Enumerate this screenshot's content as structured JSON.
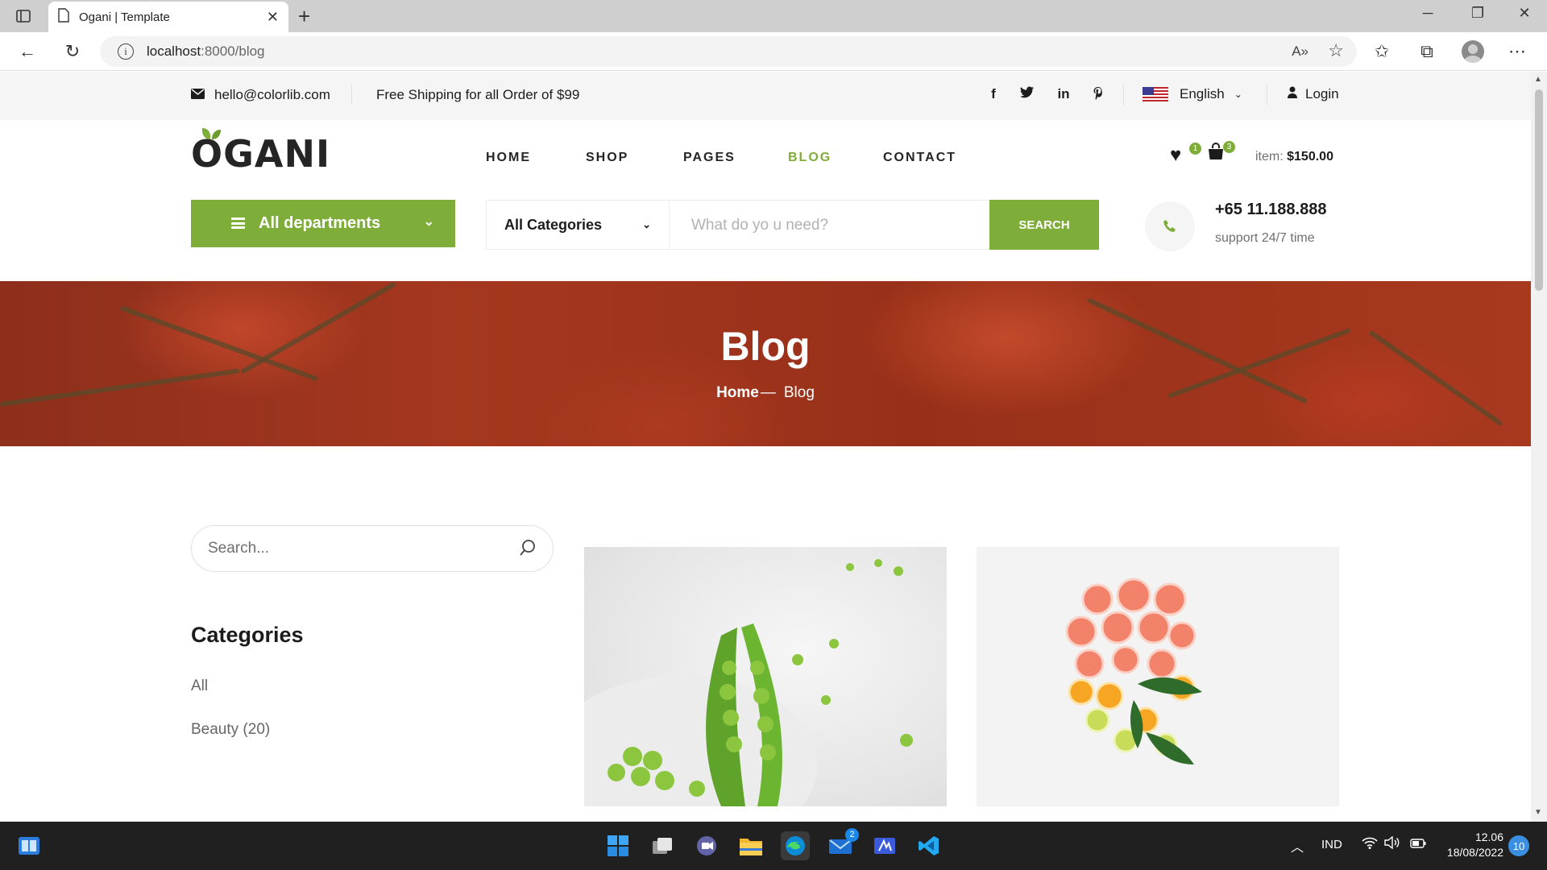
{
  "browser": {
    "tab_title": "Ogani | Template",
    "url_host": "localhost",
    "url_rest": ":8000/blog",
    "icons": [
      "tab-actions-icon",
      "page-icon",
      "close-icon",
      "new-tab-icon",
      "minimize-icon",
      "restore-icon",
      "window-close-icon",
      "back-icon",
      "refresh-icon",
      "info-icon",
      "read-aloud-icon",
      "add-favorite-icon",
      "favorites-icon",
      "collections-icon",
      "profile-icon",
      "more-icon"
    ]
  },
  "topbar": {
    "email": "hello@colorlib.com",
    "shipping": "Free Shipping for all Order of $99",
    "social": [
      "f",
      "t",
      "in",
      "p"
    ],
    "language": "English",
    "login": "Login"
  },
  "header": {
    "logo": "OGANI",
    "nav": [
      {
        "label": "HOME",
        "active": false
      },
      {
        "label": "SHOP",
        "active": false
      },
      {
        "label": "PAGES",
        "active": false
      },
      {
        "label": "BLOG",
        "active": true
      },
      {
        "label": "CONTACT",
        "active": false
      }
    ],
    "wishlist_count": "1",
    "cart_count": "3",
    "cart_label": "item:",
    "cart_total": "$150.00"
  },
  "hero_search": {
    "departments": "All departments",
    "category": "All Categories",
    "placeholder": "What do yo u need?",
    "button": "SEARCH",
    "phone": "+65 11.188.888",
    "support": "support 24/7 time"
  },
  "breadcrumb": {
    "title": "Blog",
    "home": "Home",
    "separator": "—",
    "current": "Blog"
  },
  "sidebar": {
    "search_placeholder": "Search...",
    "categories_title": "Categories",
    "items": [
      "All",
      "Beauty (20)"
    ]
  },
  "taskbar": {
    "apps": [
      "start-icon",
      "task-view-icon",
      "teams-chat-icon",
      "file-explorer-icon",
      "edge-icon",
      "mail-icon",
      "editor-icon",
      "vscode-icon"
    ],
    "mail_badge": "2",
    "language": "IND",
    "time": "12.06",
    "date": "18/08/2022",
    "notifications": "10"
  },
  "colors": {
    "accent": "#7fad39",
    "text": "#1c1c1c",
    "topbar_bg": "#f5f5f5",
    "taskbar": "#202020"
  }
}
